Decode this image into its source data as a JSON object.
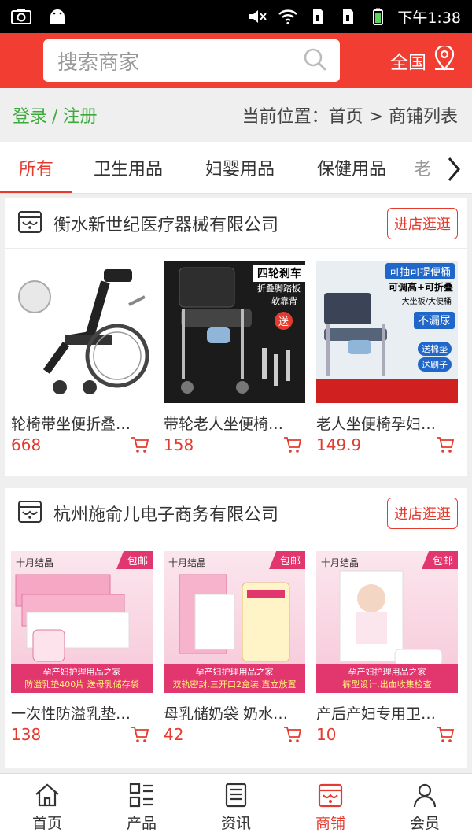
{
  "status_bar": {
    "time": "下午1:38",
    "icons": [
      "camera-icon",
      "android-icon",
      "mute-icon",
      "wifi-icon",
      "sim1-icon",
      "sim2-icon",
      "battery-icon"
    ]
  },
  "header": {
    "search_placeholder": "搜索商家",
    "region_label": "全国"
  },
  "location_bar": {
    "login": "登录",
    "separator": "/",
    "register": "注册",
    "breadcrumb": "当前位置：首页 > 商铺列表"
  },
  "tabs": [
    {
      "label": "所有",
      "active": true
    },
    {
      "label": "卫生用品"
    },
    {
      "label": "妇婴用品"
    },
    {
      "label": "保健用品"
    },
    {
      "label": "老"
    }
  ],
  "shops": [
    {
      "name": "衡水新世纪医疗器械有限公司",
      "visit_label": "进店逛逛",
      "products": [
        {
          "name": "轮椅带坐便折叠…",
          "price": "668"
        },
        {
          "name": "带轮老人坐便椅…",
          "price": "158",
          "badges": [
            "四轮刹车",
            "折叠脚踏板",
            "软靠背",
            "送"
          ]
        },
        {
          "name": "老人坐便椅孕妇…",
          "price": "149.9",
          "badges": [
            "可抽可提便桶",
            "可调高+可折叠",
            "大坐板/大便桶",
            "不漏尿",
            "送棉垫",
            "送刷子"
          ]
        }
      ]
    },
    {
      "name": "杭州施俞儿电子商务有限公司",
      "visit_label": "进店逛逛",
      "products": [
        {
          "name": "一次性防溢乳垫…",
          "price": "138",
          "brand": "十月结晶",
          "ship": "包邮",
          "tag1": "孕产妇护理用品之家",
          "tag2": "防溢乳垫400片 送母乳储存袋"
        },
        {
          "name": "母乳储奶袋 奶水…",
          "price": "42",
          "brand": "十月结晶",
          "ship": "包邮",
          "tag1": "孕产妇护理用品之家",
          "tag2": "双轨密封.三开口2盒装.直立放置"
        },
        {
          "name": "产后产妇专用卫…",
          "price": "10",
          "brand": "十月结晶",
          "ship": "包邮",
          "tag1": "孕产妇护理用品之家",
          "tag2": "裤型设计.出血收集检查"
        }
      ]
    }
  ],
  "bottom_nav": [
    {
      "label": "首页",
      "icon": "home-icon"
    },
    {
      "label": "产品",
      "icon": "grid-list-icon"
    },
    {
      "label": "资讯",
      "icon": "news-icon"
    },
    {
      "label": "商铺",
      "icon": "store-icon",
      "active": true
    },
    {
      "label": "会员",
      "icon": "user-icon"
    }
  ],
  "colors": {
    "brand_red": "#f23e32",
    "price_red": "#e53b2e",
    "login_green": "#3aab3a"
  }
}
